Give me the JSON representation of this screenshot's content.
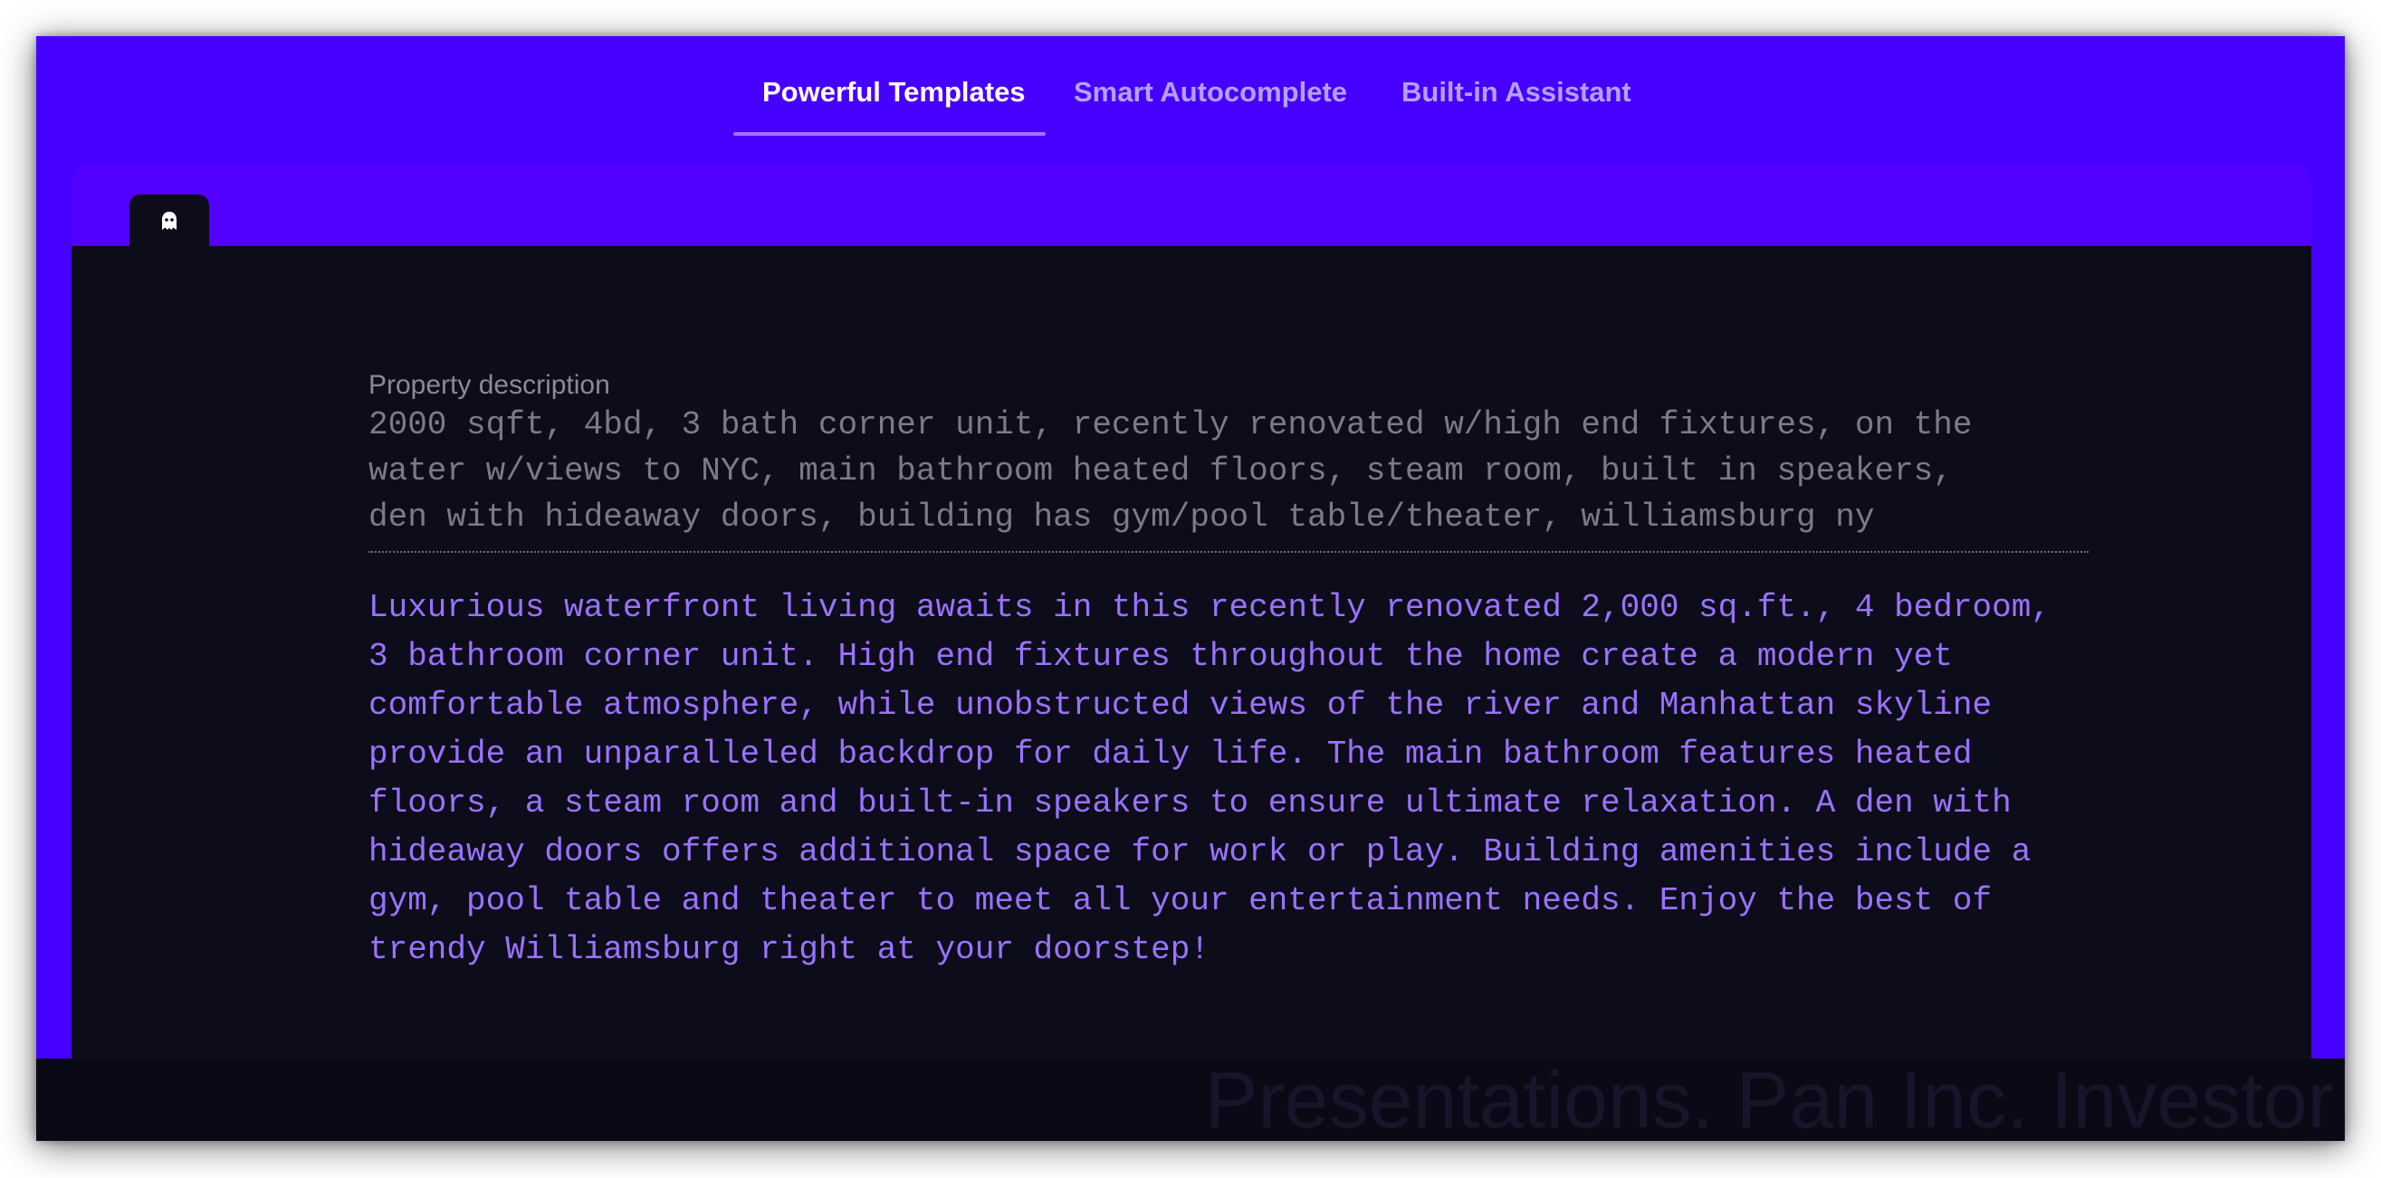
{
  "tabs": [
    {
      "label": "Powerful Templates",
      "active": true
    },
    {
      "label": "Smart Autocomplete",
      "active": false
    },
    {
      "label": "Built-in Assistant",
      "active": false
    }
  ],
  "editor": {
    "tab_icon": "ghost-icon",
    "field_label": "Property description",
    "field_value": "2000 sqft, 4bd, 3 bath corner unit, recently renovated w/high end fixtures, on the\nwater w/views to NYC, main bathroom heated floors, steam room, built in speakers,\nden with hideaway doors, building has gym/pool table/theater, williamsburg ny",
    "generated_text": "Luxurious waterfront living awaits in this recently renovated 2,000 sq.ft., 4 bedroom,\n3 bathroom corner unit. High end fixtures throughout the home create a modern yet\ncomfortable atmosphere, while unobstructed views of the river and Manhattan skyline\nprovide an unparalleled backdrop for daily life. The main bathroom features heated\nfloors, a steam room and built-in speakers to ensure ultimate relaxation. A den with\nhideaway doors offers additional space for work or play. Building amenities include a\ngym, pool table and theater to meet all your entertainment needs. Enjoy the best of\ntrendy Williamsburg right at your doorstep!"
  },
  "bottom_text": "Presentations. Pan Inc. Investor",
  "colors": {
    "background": "#4600ff",
    "panel": "#0d0c1a",
    "accent": "#a571ff",
    "generated_text": "#9a72ff"
  }
}
